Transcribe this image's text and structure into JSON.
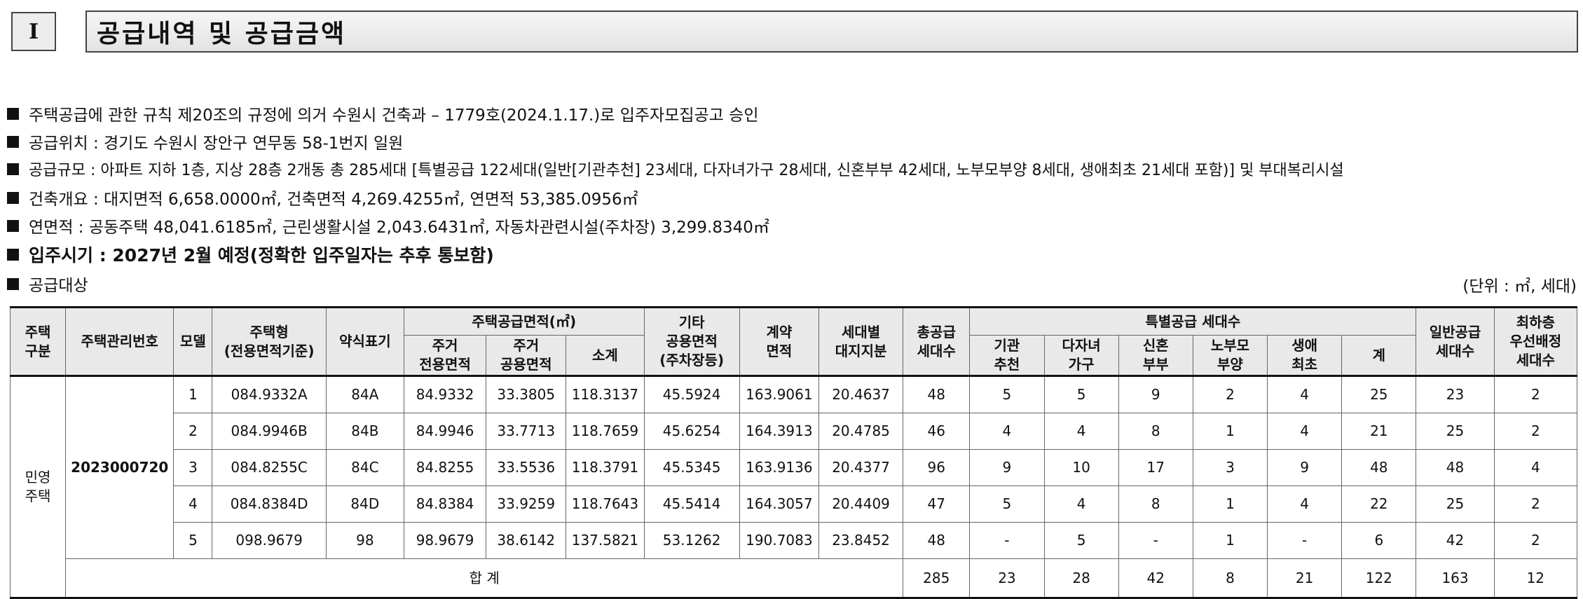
{
  "section": {
    "number": "I",
    "title": "공급내역 및 공급금액"
  },
  "lines": [
    "주택공급에 관한 규칙 제20조의 규정에 의거 수원시 건축과 – 1779호(2024.1.17.)로 입주자모집공고 승인",
    "공급위치 : 경기도 수원시 장안구 연무동 58-1번지 일원",
    "공급규모 : 아파트 지하 1층, 지상 28층 2개동 총 285세대 [특별공급 122세대(일반[기관추천] 23세대, 다자녀가구 28세대, 신혼부부 42세대, 노부모부양 8세대, 생애최초 21세대 포함)] 및 부대복리시설",
    "건축개요 : 대지면적 6,658.0000㎡, 건축면적 4,269.4255㎡, 연면적 53,385.0956㎡",
    "연면적 : 공동주택 48,041.6185㎡, 근린생활시설 2,043.6431㎡, 자동차관련시설(주차장) 3,299.8340㎡",
    "입주시기 : 2027년 2월 예정(정확한 입주일자는 추후 통보함)",
    "공급대상"
  ],
  "unit": "(단위 : ㎡, 세대)",
  "table": {
    "headers": {
      "house_type_category": [
        "주택",
        "구분"
      ],
      "management_no": "주택관리번호",
      "model": "모델",
      "house_type": [
        "주택형",
        "(전용면적기준)"
      ],
      "abbr": "약식표기",
      "area_group": "주택공급면적(㎡)",
      "exclusive": [
        "주거",
        "전용면적"
      ],
      "common": [
        "주거",
        "공용면적"
      ],
      "subtotal": "소계",
      "other_common": [
        "기타",
        "공용면적",
        "(주차장등)"
      ],
      "contract_area": [
        "계약",
        "면적"
      ],
      "land_share": [
        "세대별",
        "대지지분"
      ],
      "total_units": [
        "총공급",
        "세대수"
      ],
      "special_group": "특별공급 세대수",
      "institution": [
        "기관",
        "추천"
      ],
      "multi_child": [
        "다자녀",
        "가구"
      ],
      "newlywed": [
        "신혼",
        "부부"
      ],
      "elderly_parent": [
        "노부모",
        "부양"
      ],
      "first_time": [
        "생애",
        "최초"
      ],
      "special_total": "계",
      "general_units": [
        "일반공급",
        "세대수"
      ],
      "lowest_floor": [
        "최하층",
        "우선배정",
        "세대수"
      ]
    },
    "category": [
      "민영",
      "주택"
    ],
    "management_no": "2023000720",
    "rows": [
      {
        "model": "1",
        "type": "084.9332A",
        "abbr": "84A",
        "exclusive": "84.9332",
        "common": "33.3805",
        "subtotal": "118.3137",
        "other": "45.5924",
        "contract": "163.9061",
        "land": "20.4637",
        "total": "48",
        "institution": "5",
        "multi": "5",
        "newlywed": "9",
        "elderly": "2",
        "first": "4",
        "sp_total": "25",
        "general": "23",
        "lowest": "2"
      },
      {
        "model": "2",
        "type": "084.9946B",
        "abbr": "84B",
        "exclusive": "84.9946",
        "common": "33.7713",
        "subtotal": "118.7659",
        "other": "45.6254",
        "contract": "164.3913",
        "land": "20.4785",
        "total": "46",
        "institution": "4",
        "multi": "4",
        "newlywed": "8",
        "elderly": "1",
        "first": "4",
        "sp_total": "21",
        "general": "25",
        "lowest": "2"
      },
      {
        "model": "3",
        "type": "084.8255C",
        "abbr": "84C",
        "exclusive": "84.8255",
        "common": "33.5536",
        "subtotal": "118.3791",
        "other": "45.5345",
        "contract": "163.9136",
        "land": "20.4377",
        "total": "96",
        "institution": "9",
        "multi": "10",
        "newlywed": "17",
        "elderly": "3",
        "first": "9",
        "sp_total": "48",
        "general": "48",
        "lowest": "4"
      },
      {
        "model": "4",
        "type": "084.8384D",
        "abbr": "84D",
        "exclusive": "84.8384",
        "common": "33.9259",
        "subtotal": "118.7643",
        "other": "45.5414",
        "contract": "164.3057",
        "land": "20.4409",
        "total": "47",
        "institution": "5",
        "multi": "4",
        "newlywed": "8",
        "elderly": "1",
        "first": "4",
        "sp_total": "22",
        "general": "25",
        "lowest": "2"
      },
      {
        "model": "5",
        "type": "098.9679",
        "abbr": "98",
        "exclusive": "98.9679",
        "common": "38.6142",
        "subtotal": "137.5821",
        "other": "53.1262",
        "contract": "190.7083",
        "land": "23.8452",
        "total": "48",
        "institution": "-",
        "multi": "5",
        "newlywed": "-",
        "elderly": "1",
        "first": "-",
        "sp_total": "6",
        "general": "42",
        "lowest": "2"
      }
    ],
    "total_row": {
      "label": "합 계",
      "total": "285",
      "institution": "23",
      "multi": "28",
      "newlywed": "42",
      "elderly": "8",
      "first": "21",
      "sp_total": "122",
      "general": "163",
      "lowest": "12"
    }
  }
}
